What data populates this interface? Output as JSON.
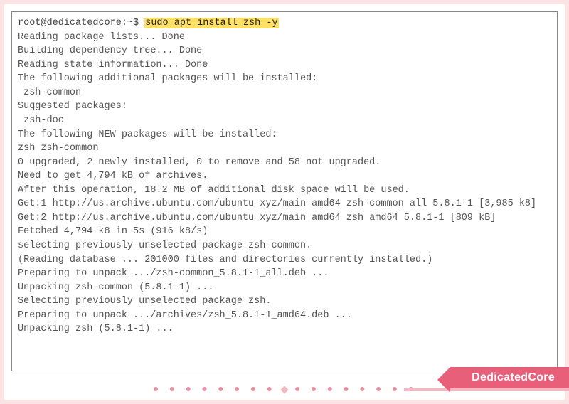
{
  "terminal": {
    "prompt": "root@dedicatedcore:~$ ",
    "command": "sudo apt install zsh -y",
    "output": [
      "Reading package lists... Done",
      "Building dependency tree... Done",
      "Reading state information... Done",
      "The following additional packages will be installed:",
      " zsh-common",
      "Suggested packages:",
      " zsh-doc",
      "The following NEW packages will be installed:",
      "zsh zsh-common",
      "0 upgraded, 2 newly installed, 0 to remove and 58 not upgraded.",
      "Need to get 4,794 kB of archives.",
      "After this operation, 18.2 MB of additional disk space will be used.",
      "Get:1 http://us.archive.ubuntu.com/ubuntu xyz/main amd64 zsh-common all 5.8.1-1 [3,985 k8]",
      "Get:2 http://us.archive.ubuntu.com/ubuntu xyz/main amd64 zsh amd64 5.8.1-1 [809 kB]",
      "Fetched 4,794 k8 in 5s (916 k8/s)",
      "selecting previously unselected package zsh-common.",
      "(Reading database ... 201000 files and directories currently installed.)",
      "Preparing to unpack .../zsh-common_5.8.1-1_all.deb ...",
      "Unpacking zsh-common (5.8.1-1) ...",
      "Selecting previously unselected package zsh.",
      "Preparing to unpack .../archives/zsh_5.8.1-1_amd64.deb ...",
      "Unpacking zsh (5.8.1-1) ..."
    ]
  },
  "brand": {
    "name": "DedicatedCore"
  },
  "decor": {
    "left_dots": "● ● ● ● ● ● ● ●",
    "right_dots": "● ● ● ● ● ● ● ●"
  }
}
